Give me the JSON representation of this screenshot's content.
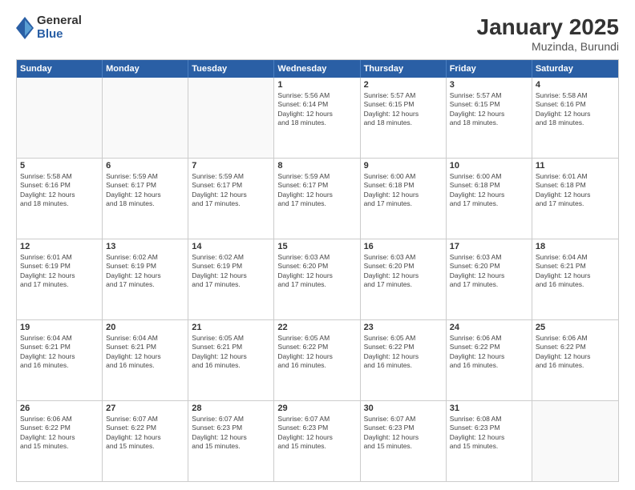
{
  "logo": {
    "general": "General",
    "blue": "Blue"
  },
  "title": "January 2025",
  "location": "Muzinda, Burundi",
  "weekdays": [
    "Sunday",
    "Monday",
    "Tuesday",
    "Wednesday",
    "Thursday",
    "Friday",
    "Saturday"
  ],
  "weeks": [
    [
      {
        "day": "",
        "info": ""
      },
      {
        "day": "",
        "info": ""
      },
      {
        "day": "",
        "info": ""
      },
      {
        "day": "1",
        "info": "Sunrise: 5:56 AM\nSunset: 6:14 PM\nDaylight: 12 hours\nand 18 minutes."
      },
      {
        "day": "2",
        "info": "Sunrise: 5:57 AM\nSunset: 6:15 PM\nDaylight: 12 hours\nand 18 minutes."
      },
      {
        "day": "3",
        "info": "Sunrise: 5:57 AM\nSunset: 6:15 PM\nDaylight: 12 hours\nand 18 minutes."
      },
      {
        "day": "4",
        "info": "Sunrise: 5:58 AM\nSunset: 6:16 PM\nDaylight: 12 hours\nand 18 minutes."
      }
    ],
    [
      {
        "day": "5",
        "info": "Sunrise: 5:58 AM\nSunset: 6:16 PM\nDaylight: 12 hours\nand 18 minutes."
      },
      {
        "day": "6",
        "info": "Sunrise: 5:59 AM\nSunset: 6:17 PM\nDaylight: 12 hours\nand 18 minutes."
      },
      {
        "day": "7",
        "info": "Sunrise: 5:59 AM\nSunset: 6:17 PM\nDaylight: 12 hours\nand 17 minutes."
      },
      {
        "day": "8",
        "info": "Sunrise: 5:59 AM\nSunset: 6:17 PM\nDaylight: 12 hours\nand 17 minutes."
      },
      {
        "day": "9",
        "info": "Sunrise: 6:00 AM\nSunset: 6:18 PM\nDaylight: 12 hours\nand 17 minutes."
      },
      {
        "day": "10",
        "info": "Sunrise: 6:00 AM\nSunset: 6:18 PM\nDaylight: 12 hours\nand 17 minutes."
      },
      {
        "day": "11",
        "info": "Sunrise: 6:01 AM\nSunset: 6:18 PM\nDaylight: 12 hours\nand 17 minutes."
      }
    ],
    [
      {
        "day": "12",
        "info": "Sunrise: 6:01 AM\nSunset: 6:19 PM\nDaylight: 12 hours\nand 17 minutes."
      },
      {
        "day": "13",
        "info": "Sunrise: 6:02 AM\nSunset: 6:19 PM\nDaylight: 12 hours\nand 17 minutes."
      },
      {
        "day": "14",
        "info": "Sunrise: 6:02 AM\nSunset: 6:19 PM\nDaylight: 12 hours\nand 17 minutes."
      },
      {
        "day": "15",
        "info": "Sunrise: 6:03 AM\nSunset: 6:20 PM\nDaylight: 12 hours\nand 17 minutes."
      },
      {
        "day": "16",
        "info": "Sunrise: 6:03 AM\nSunset: 6:20 PM\nDaylight: 12 hours\nand 17 minutes."
      },
      {
        "day": "17",
        "info": "Sunrise: 6:03 AM\nSunset: 6:20 PM\nDaylight: 12 hours\nand 17 minutes."
      },
      {
        "day": "18",
        "info": "Sunrise: 6:04 AM\nSunset: 6:21 PM\nDaylight: 12 hours\nand 16 minutes."
      }
    ],
    [
      {
        "day": "19",
        "info": "Sunrise: 6:04 AM\nSunset: 6:21 PM\nDaylight: 12 hours\nand 16 minutes."
      },
      {
        "day": "20",
        "info": "Sunrise: 6:04 AM\nSunset: 6:21 PM\nDaylight: 12 hours\nand 16 minutes."
      },
      {
        "day": "21",
        "info": "Sunrise: 6:05 AM\nSunset: 6:21 PM\nDaylight: 12 hours\nand 16 minutes."
      },
      {
        "day": "22",
        "info": "Sunrise: 6:05 AM\nSunset: 6:22 PM\nDaylight: 12 hours\nand 16 minutes."
      },
      {
        "day": "23",
        "info": "Sunrise: 6:05 AM\nSunset: 6:22 PM\nDaylight: 12 hours\nand 16 minutes."
      },
      {
        "day": "24",
        "info": "Sunrise: 6:06 AM\nSunset: 6:22 PM\nDaylight: 12 hours\nand 16 minutes."
      },
      {
        "day": "25",
        "info": "Sunrise: 6:06 AM\nSunset: 6:22 PM\nDaylight: 12 hours\nand 16 minutes."
      }
    ],
    [
      {
        "day": "26",
        "info": "Sunrise: 6:06 AM\nSunset: 6:22 PM\nDaylight: 12 hours\nand 15 minutes."
      },
      {
        "day": "27",
        "info": "Sunrise: 6:07 AM\nSunset: 6:22 PM\nDaylight: 12 hours\nand 15 minutes."
      },
      {
        "day": "28",
        "info": "Sunrise: 6:07 AM\nSunset: 6:23 PM\nDaylight: 12 hours\nand 15 minutes."
      },
      {
        "day": "29",
        "info": "Sunrise: 6:07 AM\nSunset: 6:23 PM\nDaylight: 12 hours\nand 15 minutes."
      },
      {
        "day": "30",
        "info": "Sunrise: 6:07 AM\nSunset: 6:23 PM\nDaylight: 12 hours\nand 15 minutes."
      },
      {
        "day": "31",
        "info": "Sunrise: 6:08 AM\nSunset: 6:23 PM\nDaylight: 12 hours\nand 15 minutes."
      },
      {
        "day": "",
        "info": ""
      }
    ]
  ]
}
